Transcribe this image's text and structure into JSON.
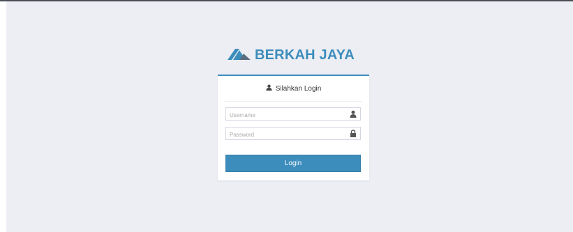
{
  "brand": {
    "name": "BERKAH JAYA",
    "logo_icon": "mountain-logo-icon",
    "color": "#3c8dbc"
  },
  "login": {
    "header_icon": "user-icon",
    "header_text": "Silahkan Login",
    "username": {
      "placeholder": "Username",
      "value": "",
      "icon": "user-icon"
    },
    "password": {
      "placeholder": "Password",
      "value": "",
      "icon": "lock-icon"
    },
    "button_label": "Login",
    "accent_color": "#3c8dbc"
  }
}
